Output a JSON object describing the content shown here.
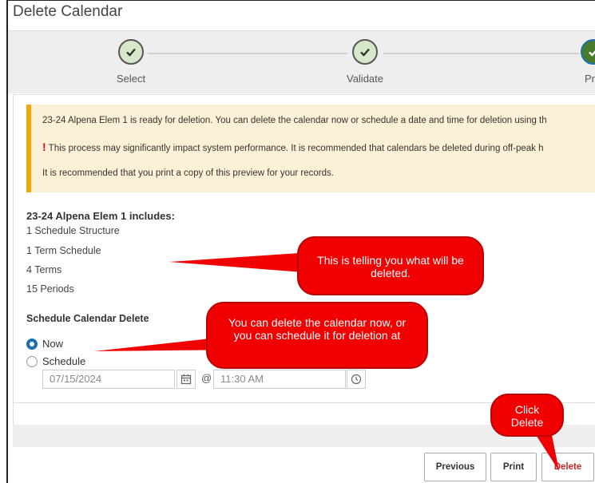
{
  "window": {
    "title": "Delete Calendar"
  },
  "stepper": {
    "steps": [
      {
        "label": "Select",
        "state": "complete"
      },
      {
        "label": "Validate",
        "state": "complete"
      },
      {
        "label": "Pre",
        "state": "active"
      }
    ]
  },
  "alert": {
    "line1": "23-24 Alpena Elem 1 is ready for deletion. You can delete the calendar now or schedule a date and time for deletion using th",
    "line2_mark": "!",
    "line2": "This process may significantly impact system performance. It is recommended that calendars be deleted during off-peak h",
    "line3": "It is recommended that you print a copy of this preview for your records."
  },
  "includes": {
    "title": "23-24 Alpena Elem 1 includes:",
    "items": [
      "1 Schedule Structure",
      "1 Term Schedule",
      "4 Terms",
      "15 Periods"
    ]
  },
  "schedule": {
    "title": "Schedule Calendar Delete",
    "options": [
      {
        "label": "Now",
        "checked": true
      },
      {
        "label": "Schedule",
        "checked": false
      }
    ],
    "date_value": "07/15/2024",
    "at": "@",
    "time_value": "11:30 AM"
  },
  "buttons": {
    "previous": "Previous",
    "print": "Print",
    "delete": "Delete"
  },
  "callouts": {
    "deleted": "This is telling you what will be deleted.",
    "schedule": "You can delete the calendar now, or you can schedule it for deletion at",
    "click": "Click Delete"
  },
  "colors": {
    "alert_bg": "#fcf1d6",
    "alert_border": "#f0a900",
    "step_complete": "#d7e7c9",
    "step_active": "#4a7a2c",
    "radio_checked": "#1a6fb5",
    "callout": "#f00000"
  }
}
